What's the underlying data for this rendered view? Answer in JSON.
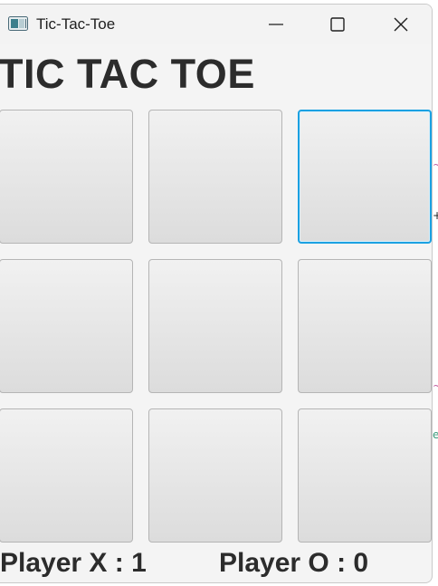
{
  "window": {
    "title": "Tic-Tac-Toe",
    "app_icon": "java-app-icon",
    "controls": [
      "minimize-icon",
      "maximize-icon",
      "close-icon"
    ]
  },
  "game": {
    "heading": "TIC TAC TOE",
    "board": [
      [
        "",
        "",
        ""
      ],
      [
        "",
        "",
        ""
      ],
      [
        "",
        "",
        ""
      ]
    ],
    "focused_cell": "row 1, column 3"
  },
  "score": {
    "player_x": "Player X : 1",
    "player_o": "Player O : 0"
  },
  "colors": {
    "focus_ring": "#1ba1e2",
    "heading_text": "#2c2c2c",
    "window_bg": "#f4f4f4"
  }
}
